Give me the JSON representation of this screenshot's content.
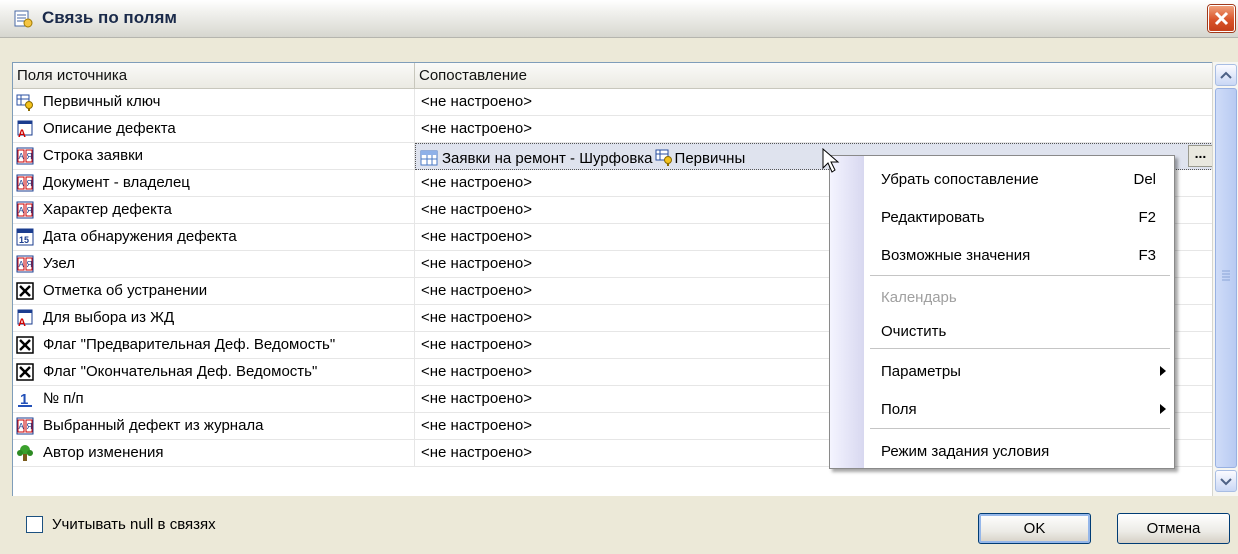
{
  "window": {
    "title": "Связь по полям"
  },
  "grid": {
    "headers": [
      "Поля источника",
      "Сопоставление"
    ],
    "rows": [
      {
        "field": "Первичный ключ",
        "icon": "key-icon",
        "mapping": "<не настроено>"
      },
      {
        "field": "Описание  дефекта",
        "icon": "text-icon",
        "mapping": "<не настроено>"
      },
      {
        "field": "Строка заявки",
        "icon": "string-icon",
        "mapping": ""
      },
      {
        "field": "Документ - владелец",
        "icon": "string-icon",
        "mapping": "<не настроено>"
      },
      {
        "field": "Характер дефекта",
        "icon": "string-icon",
        "mapping": "<не настроено>"
      },
      {
        "field": "Дата обнаружения дефекта",
        "icon": "date-icon",
        "mapping": "<не настроено>"
      },
      {
        "field": "Узел",
        "icon": "string-icon",
        "mapping": "<не настроено>"
      },
      {
        "field": "Отметка об устранении",
        "icon": "checkbox-icon",
        "mapping": "<не настроено>"
      },
      {
        "field": "Для выбора из ЖД",
        "icon": "text-icon",
        "mapping": "<не настроено>"
      },
      {
        "field": "Флаг \"Предварительная Деф. Ведомость\"",
        "icon": "checkbox-icon",
        "mapping": "<не настроено>"
      },
      {
        "field": "Флаг \"Окончательная Деф. Ведомость\"",
        "icon": "checkbox-icon",
        "mapping": "<не настроено>"
      },
      {
        "field": "№ п/п",
        "icon": "number-icon",
        "mapping": "<не настроено>"
      },
      {
        "field": "Выбранный дефект из журнала",
        "icon": "string-icon",
        "mapping": "<не настроено>"
      },
      {
        "field": "Автор изменения",
        "icon": "user-tree-icon",
        "mapping": "<не настроено>"
      }
    ],
    "selected_mapping": {
      "table": "Заявки на ремонт - Шурфовка",
      "field": "Первичны"
    },
    "ellipsis": "..."
  },
  "context_menu": {
    "items": [
      {
        "label": "Убрать сопоставление",
        "shortcut": "Del"
      },
      {
        "label": "Редактировать",
        "shortcut": "F2"
      },
      {
        "label": "Возможные значения",
        "shortcut": "F3"
      },
      {
        "label": "Календарь",
        "disabled": true
      },
      {
        "label": "Очистить"
      },
      {
        "label": "Параметры",
        "submenu": true
      },
      {
        "label": "Поля",
        "submenu": true
      },
      {
        "label": "Режим задания условия"
      }
    ]
  },
  "footer": {
    "checkbox_label": "Учитывать null в связях",
    "ok_label": "OK",
    "cancel_label": "Отмена"
  },
  "colors": {
    "title_text": "#1a2a4a",
    "selection_bg": "#dfe3ee",
    "close_red": "#d9542a"
  }
}
